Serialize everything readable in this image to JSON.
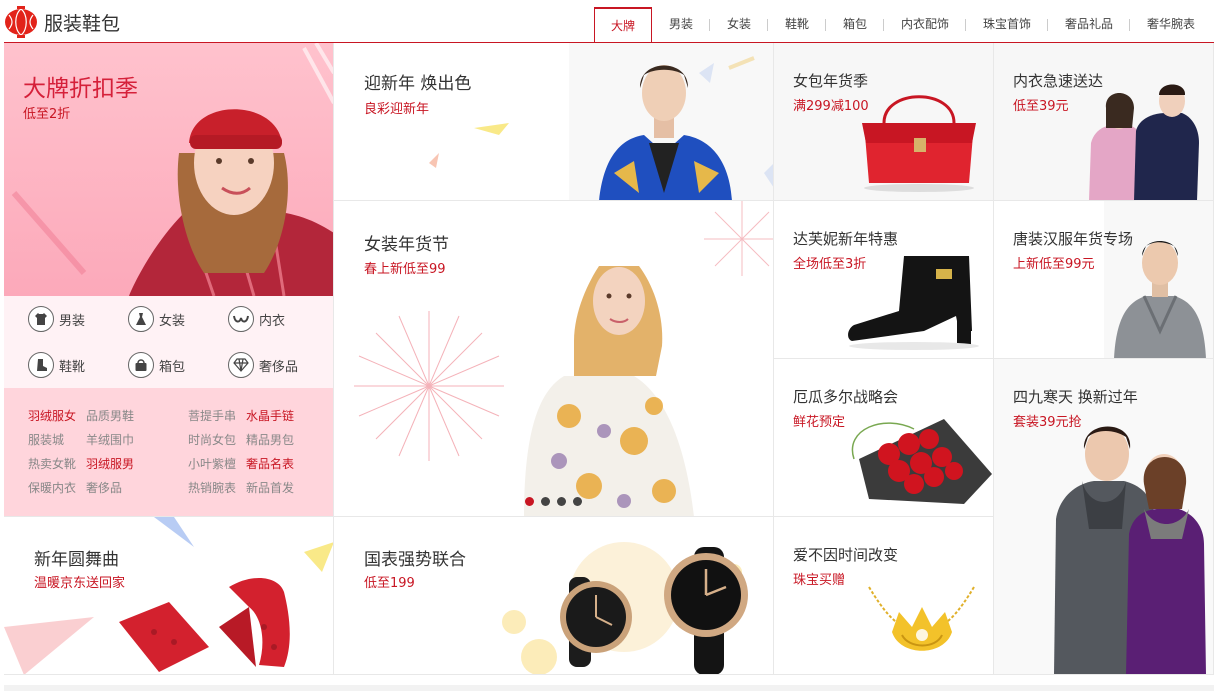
{
  "header": {
    "title": "服装鞋包",
    "tabs": [
      "大牌",
      "男装",
      "女装",
      "鞋靴",
      "箱包",
      "内衣配饰",
      "珠宝首饰",
      "奢品礼品",
      "奢华腕表"
    ],
    "active_tab": "大牌"
  },
  "promo": {
    "title": "大牌折扣季",
    "subtitle": "低至2折",
    "categories": [
      {
        "label": "男装",
        "icon": "shirt-icon"
      },
      {
        "label": "女装",
        "icon": "dress-icon"
      },
      {
        "label": "内衣",
        "icon": "bra-icon"
      },
      {
        "label": "鞋靴",
        "icon": "boot-icon"
      },
      {
        "label": "箱包",
        "icon": "bag-icon"
      },
      {
        "label": "奢侈品",
        "icon": "diamond-icon"
      }
    ],
    "links": [
      {
        "text": "羽绒服女",
        "hot": true
      },
      {
        "text": "品质男鞋",
        "hot": false
      },
      {
        "text": "菩提手串",
        "hot": false
      },
      {
        "text": "水晶手链",
        "hot": true
      },
      {
        "text": "服装城",
        "hot": false
      },
      {
        "text": "羊绒围巾",
        "hot": false
      },
      {
        "text": "时尚女包",
        "hot": false
      },
      {
        "text": "精品男包",
        "hot": false
      },
      {
        "text": "热卖女靴",
        "hot": false
      },
      {
        "text": "羽绒服男",
        "hot": true
      },
      {
        "text": "小叶紫檀",
        "hot": false
      },
      {
        "text": "奢品名表",
        "hot": true
      },
      {
        "text": "保暖内衣",
        "hot": false
      },
      {
        "text": "奢侈品",
        "hot": false
      },
      {
        "text": "热销腕表",
        "hot": false
      },
      {
        "text": "新品首发",
        "hot": false
      }
    ]
  },
  "tiles": {
    "new_year": {
      "title": "迎新年 焕出色",
      "subtitle": "良彩迎新年"
    },
    "women_festival": {
      "title": "女装年货节",
      "subtitle": "春上新低至99"
    },
    "dance": {
      "title": "新年圆舞曲",
      "subtitle": "温暖京东送回家"
    },
    "watch": {
      "title": "国表强势联合",
      "subtitle": "低至199"
    },
    "bag": {
      "title": "女包年货季",
      "subtitle": "满299减100"
    },
    "underwear": {
      "title": "内衣急速送达",
      "subtitle": "低至39元"
    },
    "boots": {
      "title": "达芙妮新年特惠",
      "subtitle": "全场低至3折"
    },
    "tang": {
      "title": "唐装汉服年货专场",
      "subtitle": "上新低至99元"
    },
    "ecuador": {
      "title": "厄瓜多尔战略会",
      "subtitle": "鲜花预定"
    },
    "winter": {
      "title": "四九寒天 换新过年",
      "subtitle": "套装39元抢"
    },
    "jewelry": {
      "title": "爱不因时间改变",
      "subtitle": "珠宝买赠"
    }
  },
  "carousel": {
    "dots": 4,
    "active": 0
  },
  "colors": {
    "brand_red": "#c81623",
    "promo_pink": "#ffc4cf"
  }
}
